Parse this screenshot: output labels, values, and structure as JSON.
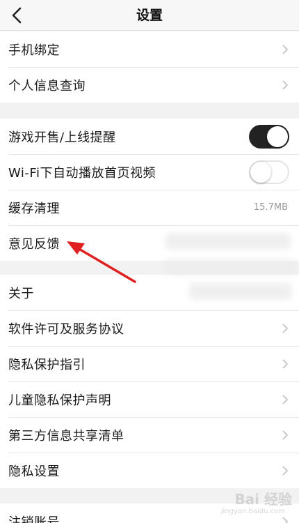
{
  "header": {
    "title": "设置"
  },
  "group1": [
    {
      "label": "手机绑定"
    },
    {
      "label": "个人信息查询"
    }
  ],
  "group2": {
    "game_reminder": {
      "label": "游戏开售/上线提醒",
      "on": true
    },
    "wifi_autoplay": {
      "label": "Wi-Fi下自动播放首页视频",
      "on": false
    },
    "cache": {
      "label": "缓存清理",
      "value": "15.7MB"
    },
    "feedback": {
      "label": "意见反馈"
    }
  },
  "group3": [
    {
      "label": "关于"
    },
    {
      "label": "软件许可及服务协议"
    },
    {
      "label": "隐私保护指引"
    },
    {
      "label": "儿童隐私保护声明"
    },
    {
      "label": "第三方信息共享清单"
    },
    {
      "label": "隐私设置"
    }
  ],
  "group4": [
    {
      "label": "注销账号"
    }
  ],
  "annotation": {
    "color": "#e02020"
  },
  "watermark": {
    "text": "Bai 经验",
    "sub": "jingyan.baidu.com"
  }
}
